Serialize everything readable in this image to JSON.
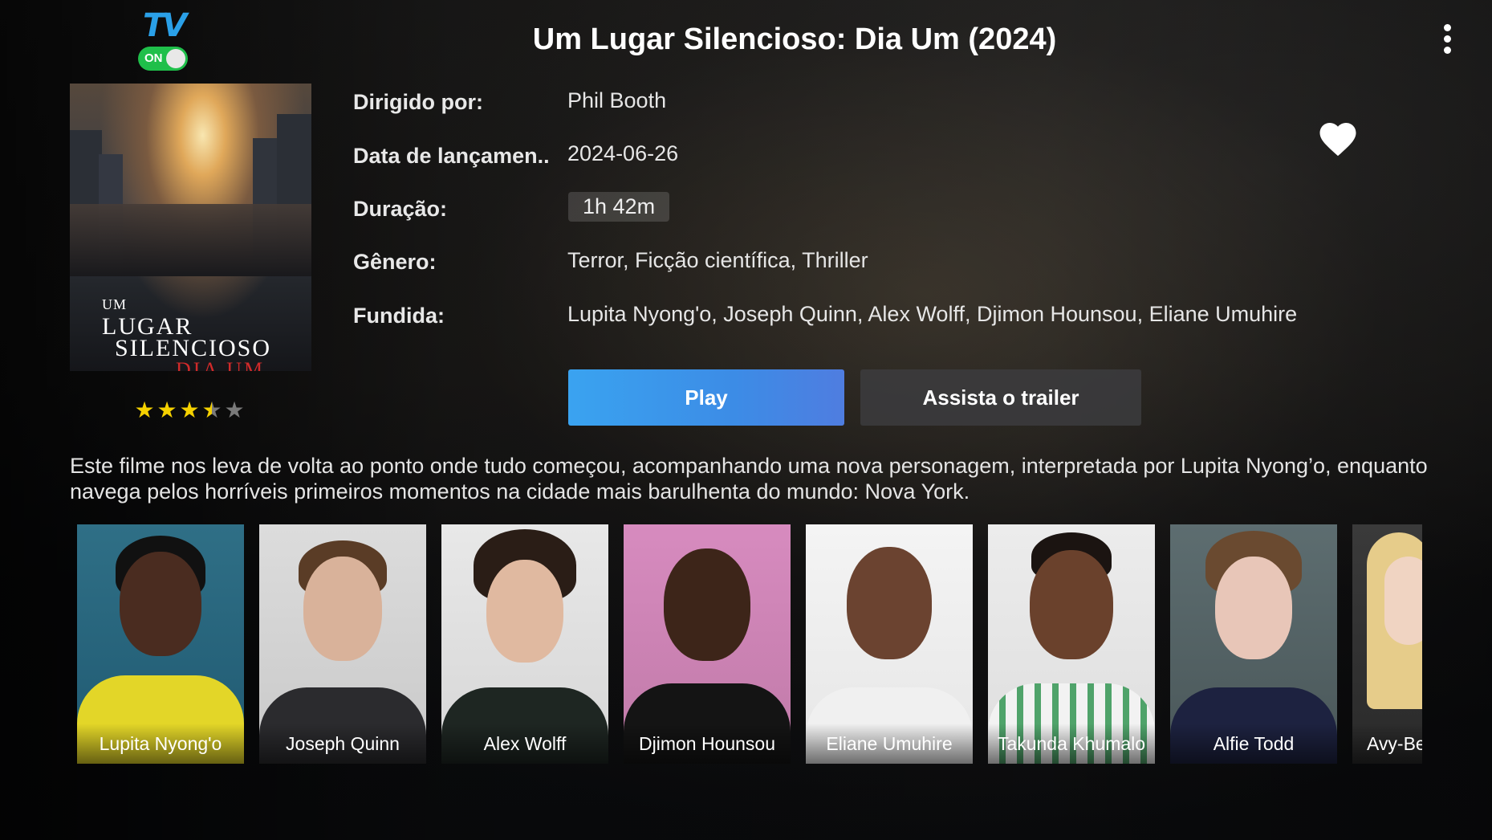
{
  "app": {
    "logo_text": "TV",
    "logo_toggle": "ON"
  },
  "header": {
    "title": "Um Lugar Silencioso: Dia Um (2024)"
  },
  "poster": {
    "line1": "UM",
    "line2": "LUGAR",
    "line3": "SILENCIOSO",
    "line4": "DIA UM"
  },
  "rating": {
    "stars_out_of_5": 3.5
  },
  "details": {
    "director_label": "Dirigido por:",
    "director_value": "Phil Booth",
    "release_label": "Data de lançamen..",
    "release_value": "2024-06-26",
    "duration_label": "Duração:",
    "duration_value": "1h 42m",
    "genre_label": "Gênero:",
    "genre_value": "Terror, Ficção científica, Thriller",
    "cast_label": "Fundida:",
    "cast_value": "Lupita Nyong'o, Joseph Quinn, Alex Wolff, Djimon Hounsou, Eliane Umuhire"
  },
  "buttons": {
    "play": "Play",
    "trailer": "Assista o trailer"
  },
  "synopsis": "Este filme nos leva de volta ao ponto onde tudo começou, acompanhando uma nova personagem, interpretada por Lupita Nyong’o, enquanto navega pelos horríveis primeiros momentos na cidade mais barulhenta do mundo: Nova York.",
  "cast": [
    {
      "name": "Lupita Nyong'o"
    },
    {
      "name": "Joseph Quinn"
    },
    {
      "name": "Alex Wolff"
    },
    {
      "name": "Djimon Hounsou"
    },
    {
      "name": "Eliane Umuhire"
    },
    {
      "name": "Takunda Khumalo"
    },
    {
      "name": "Alfie Todd"
    },
    {
      "name": "Avy-Be"
    }
  ],
  "colors": {
    "play_button": "#3c8ce6",
    "toggle": "#1fbf4a",
    "star": "#f5d100",
    "poster_accent": "#d02a2a"
  }
}
